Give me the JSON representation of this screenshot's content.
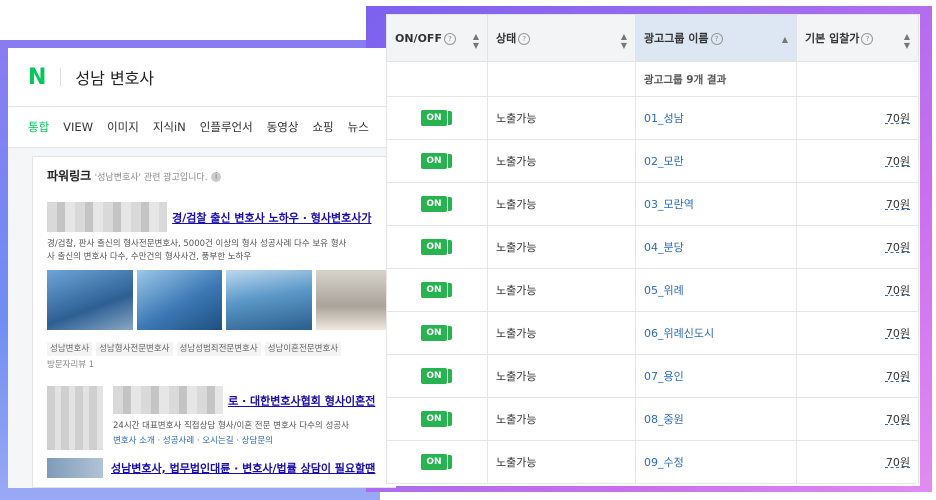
{
  "naver": {
    "logo": "N",
    "query": "성남 변호사",
    "tabs": [
      "통합",
      "VIEW",
      "이미지",
      "지식iN",
      "인플루언서",
      "동영상",
      "쇼핑",
      "뉴스"
    ],
    "powerlink_title": "파워링크",
    "powerlink_sub": "'성남변호사' 관련 광고입니다.",
    "ad1_title": "경/검찰 출신 변호사 노하우 · 형사변호사가 ",
    "ad1_desc1": "경/검찰, 판사 출신의 형사전문변호사, 5000건 이상의 형사 성공사례 다수 보유 형사",
    "ad1_desc2": "사 출신의 변호사 다수, 수만건의 형사사건, 풍부한 노하우",
    "ad1_tags": [
      "성남변호사",
      "성남형사전문변호사",
      "성남성범죄전문변호사",
      "성남이혼전문변호사"
    ],
    "ad1_sub": "방문자리뷰 1",
    "ad2_title": "로 · 대한변호사협회 형사이혼전",
    "ad2_desc": "24시간 대표변호사 직접상담 형사/이혼 전문 변호사 다수의 성공사",
    "ad2_links": "변호사 소개 · 성공사례 · 오시는길 · 상담문의",
    "ad3_title": "성남변호사, 법무법인대륜 · 변호사/법률 상담이 필요할땐"
  },
  "table": {
    "headers": {
      "onoff": "ON/OFF",
      "status": "상태",
      "group_name": "광고그룹 이름",
      "bid": "기본 입찰가"
    },
    "summary": "광고그룹 9개 결과",
    "on_label": "ON",
    "rows": [
      {
        "status": "노출가능",
        "name": "01_성남",
        "bid": "70원"
      },
      {
        "status": "노출가능",
        "name": "02_모란",
        "bid": "70원"
      },
      {
        "status": "노출가능",
        "name": "03_모란역",
        "bid": "70원"
      },
      {
        "status": "노출가능",
        "name": "04_분당",
        "bid": "70원"
      },
      {
        "status": "노출가능",
        "name": "05_위례",
        "bid": "70원"
      },
      {
        "status": "노출가능",
        "name": "06_위례신도시",
        "bid": "70원"
      },
      {
        "status": "노출가능",
        "name": "07_용인",
        "bid": "70원"
      },
      {
        "status": "노출가능",
        "name": "08_중원",
        "bid": "70원"
      },
      {
        "status": "노출가능",
        "name": "09_수정",
        "bid": "70원"
      }
    ]
  },
  "colors": {
    "naver_green": "#03c75a",
    "on_green": "#27b34f",
    "link_blue": "#2b6cb8"
  }
}
